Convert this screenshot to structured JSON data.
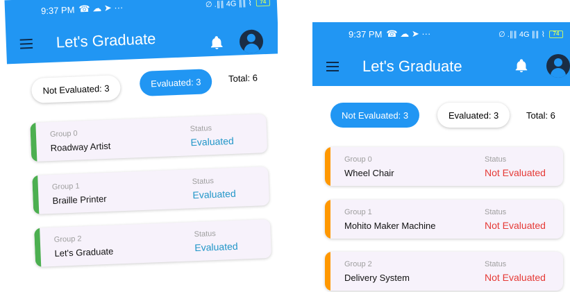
{
  "colors": {
    "primary": "#2196f3",
    "evaluated_stripe": "#4caf50",
    "not_evaluated_stripe": "#ff9800",
    "evaluated_text": "#2196c8",
    "not_evaluated_text": "#e53935"
  },
  "status_bar": {
    "time": "9:37 PM",
    "left_icons": "☎ ☁ ➤ ···",
    "right_icons": "∅ .∥∥ 4G ∥∥ ⌇",
    "battery": "74"
  },
  "app": {
    "title": "Let's Graduate"
  },
  "left": {
    "filters": {
      "not_evaluated": "Not Evaluated: 3",
      "evaluated": "Evaluated: 3",
      "total": "Total: 6",
      "active": "evaluated"
    },
    "projects": [
      {
        "group": "Group 0",
        "name": "Roadway Artist",
        "status_label": "Status",
        "status": "Evaluated"
      },
      {
        "group": "Group 1",
        "name": "Braille Printer",
        "status_label": "Status",
        "status": "Evaluated"
      },
      {
        "group": "Group 2",
        "name": "Let's Graduate",
        "status_label": "Status",
        "status": "Evaluated"
      }
    ]
  },
  "right": {
    "filters": {
      "not_evaluated": "Not Evaluated: 3",
      "evaluated": "Evaluated: 3",
      "total": "Total: 6",
      "active": "not_evaluated"
    },
    "projects": [
      {
        "group": "Group 0",
        "name": "Wheel Chair",
        "status_label": "Status",
        "status": "Not Evaluated"
      },
      {
        "group": "Group 1",
        "name": "Mohito Maker Machine",
        "status_label": "Status",
        "status": "Not Evaluated"
      },
      {
        "group": "Group 2",
        "name": "Delivery System",
        "status_label": "Status",
        "status": "Not Evaluated"
      }
    ]
  }
}
